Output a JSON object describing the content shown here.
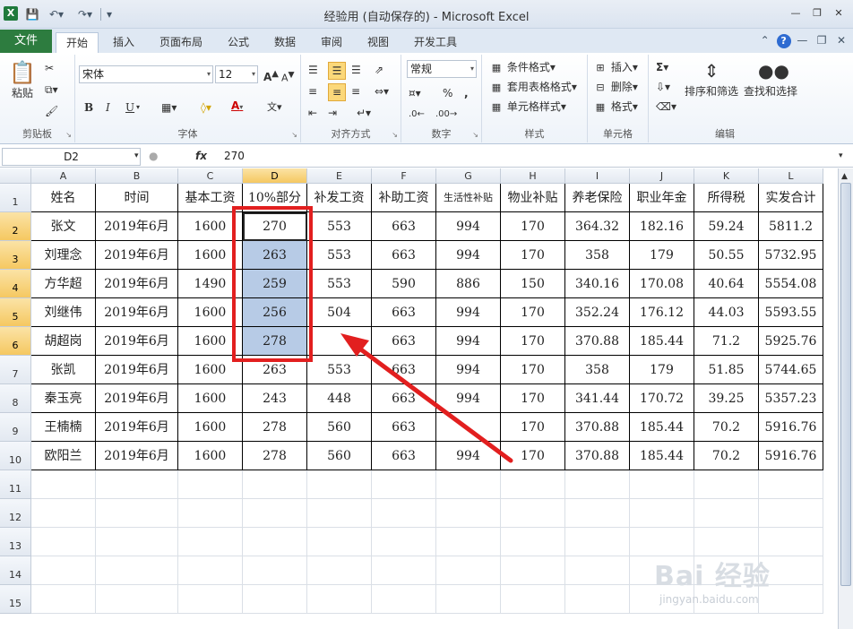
{
  "window": {
    "title": "经验用 (自动保存的) - Microsoft Excel",
    "app_icon": "X"
  },
  "ribbon_tabs": [
    "开始",
    "插入",
    "页面布局",
    "公式",
    "数据",
    "审阅",
    "视图",
    "开发工具"
  ],
  "file_tab": "文件",
  "ribbon": {
    "paste_label": "粘贴",
    "clipboard_label": "剪贴板",
    "font_name": "宋体",
    "font_size": "12",
    "font_label": "字体",
    "align_label": "对齐方式",
    "number_format": "常规",
    "number_label": "数字",
    "cond_format": "条件格式",
    "table_format": "套用表格格式",
    "cell_style": "单元格样式",
    "styles_label": "样式",
    "insert": "插入",
    "delete": "删除",
    "format": "格式",
    "cells_label": "单元格",
    "sort_filter": "排序和筛选",
    "find_select": "查找和选择",
    "edit_label": "编辑",
    "bold": "B",
    "italic": "I",
    "underline": "U",
    "percent": "%",
    "comma": ","
  },
  "formula_bar": {
    "name_box": "D2",
    "fx": "fx",
    "value": "270"
  },
  "columns": [
    "A",
    "B",
    "C",
    "D",
    "E",
    "F",
    "G",
    "H",
    "I",
    "J",
    "K",
    "L"
  ],
  "selected_column": "D",
  "rows": [
    "1",
    "2",
    "3",
    "4",
    "5",
    "6",
    "7",
    "8",
    "9",
    "10",
    "11",
    "12",
    "13",
    "14",
    "15"
  ],
  "selected_rows": [
    "2",
    "3",
    "4",
    "5",
    "6"
  ],
  "table": {
    "headers": [
      "姓名",
      "时间",
      "基本工资",
      "10%部分",
      "补发工资",
      "补助工资",
      "生活性补贴",
      "物业补贴",
      "养老保险",
      "职业年金",
      "所得税",
      "实发合计"
    ],
    "data": [
      [
        "张文",
        "2019年6月",
        "1600",
        "270",
        "553",
        "663",
        "994",
        "170",
        "364.32",
        "182.16",
        "59.24",
        "5811.2"
      ],
      [
        "刘理念",
        "2019年6月",
        "1600",
        "263",
        "553",
        "663",
        "994",
        "170",
        "358",
        "179",
        "50.55",
        "5732.95"
      ],
      [
        "方华超",
        "2019年6月",
        "1490",
        "259",
        "553",
        "590",
        "886",
        "150",
        "340.16",
        "170.08",
        "40.64",
        "5554.08"
      ],
      [
        "刘继伟",
        "2019年6月",
        "1600",
        "256",
        "504",
        "663",
        "994",
        "170",
        "352.24",
        "176.12",
        "44.03",
        "5593.55"
      ],
      [
        "胡超岗",
        "2019年6月",
        "1600",
        "278",
        "",
        "663",
        "994",
        "170",
        "370.88",
        "185.44",
        "71.2",
        "5925.76"
      ],
      [
        "张凯",
        "2019年6月",
        "1600",
        "263",
        "553",
        "663",
        "994",
        "170",
        "358",
        "179",
        "51.85",
        "5744.65"
      ],
      [
        "秦玉亮",
        "2019年6月",
        "1600",
        "243",
        "448",
        "663",
        "994",
        "170",
        "341.44",
        "170.72",
        "39.25",
        "5357.23"
      ],
      [
        "王楠楠",
        "2019年6月",
        "1600",
        "278",
        "560",
        "663",
        "",
        "170",
        "370.88",
        "185.44",
        "70.2",
        "5916.76"
      ],
      [
        "欧阳兰",
        "2019年6月",
        "1600",
        "278",
        "560",
        "663",
        "994",
        "170",
        "370.88",
        "185.44",
        "70.2",
        "5916.76"
      ]
    ]
  },
  "watermark": {
    "main": "Bai 经验",
    "sub": "jingyan.baidu.com"
  },
  "colors": {
    "file_tab": "#2d7c3f",
    "selection": "#b7cbe6",
    "highlight_box": "#e21f1f",
    "header_selected": "#f5c861"
  }
}
